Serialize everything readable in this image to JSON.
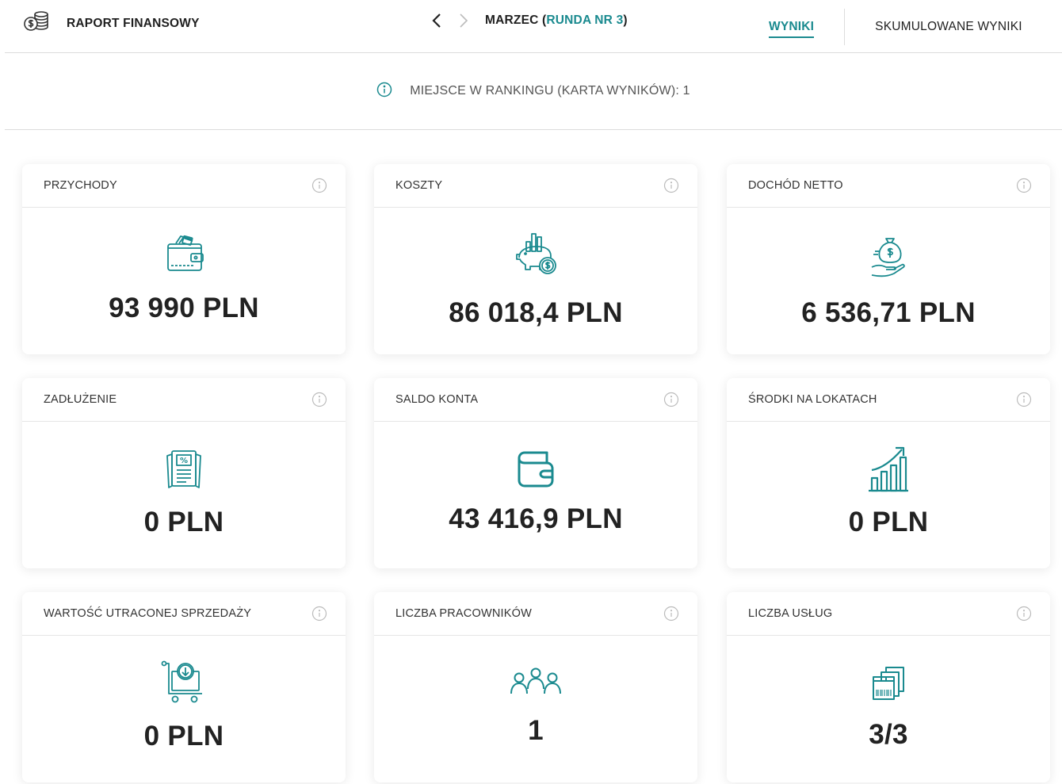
{
  "header": {
    "title": "RAPORT FINANSOWY",
    "period_main": "MARZEC (",
    "period_accent": "RUNDA NR 3",
    "period_close": ")",
    "tabs": [
      {
        "label": "WYNIKI",
        "active": true
      },
      {
        "label": "SKUMULOWANE WYNIKI",
        "active": false
      }
    ]
  },
  "ranking": {
    "text": "MIEJSCE W RANKINGU (KARTA WYNIKÓW): 1"
  },
  "cards": [
    {
      "label": "PRZYCHODY",
      "value": "93 990 PLN",
      "icon": "wallet-cash-icon"
    },
    {
      "label": "KOSZTY",
      "value": "86 018,4 PLN",
      "icon": "piggy-bank-chart-icon"
    },
    {
      "label": "DOCHÓD NETTO",
      "value": "6 536,71 PLN",
      "icon": "money-bag-hand-icon"
    },
    {
      "label": "ZADŁUŻENIE",
      "value": "0 PLN",
      "icon": "percent-document-icon"
    },
    {
      "label": "SALDO KONTA",
      "value": "43 416,9 PLN",
      "icon": "wallet-icon"
    },
    {
      "label": "ŚRODKI NA LOKATACH",
      "value": "0 PLN",
      "icon": "growth-chart-icon"
    },
    {
      "label": "WARTOŚĆ UTRACONEJ SPRZEDAŻY",
      "value": "0 PLN",
      "icon": "cart-download-icon"
    },
    {
      "label": "LICZBA PRACOWNIKÓW",
      "value": "1",
      "icon": "team-icon"
    },
    {
      "label": "LICZBA USŁUG",
      "value": "3/3",
      "icon": "packages-icon"
    }
  ],
  "colors": {
    "accent": "#1a8a8f",
    "text": "#222222",
    "divider": "#dcdcdc"
  }
}
